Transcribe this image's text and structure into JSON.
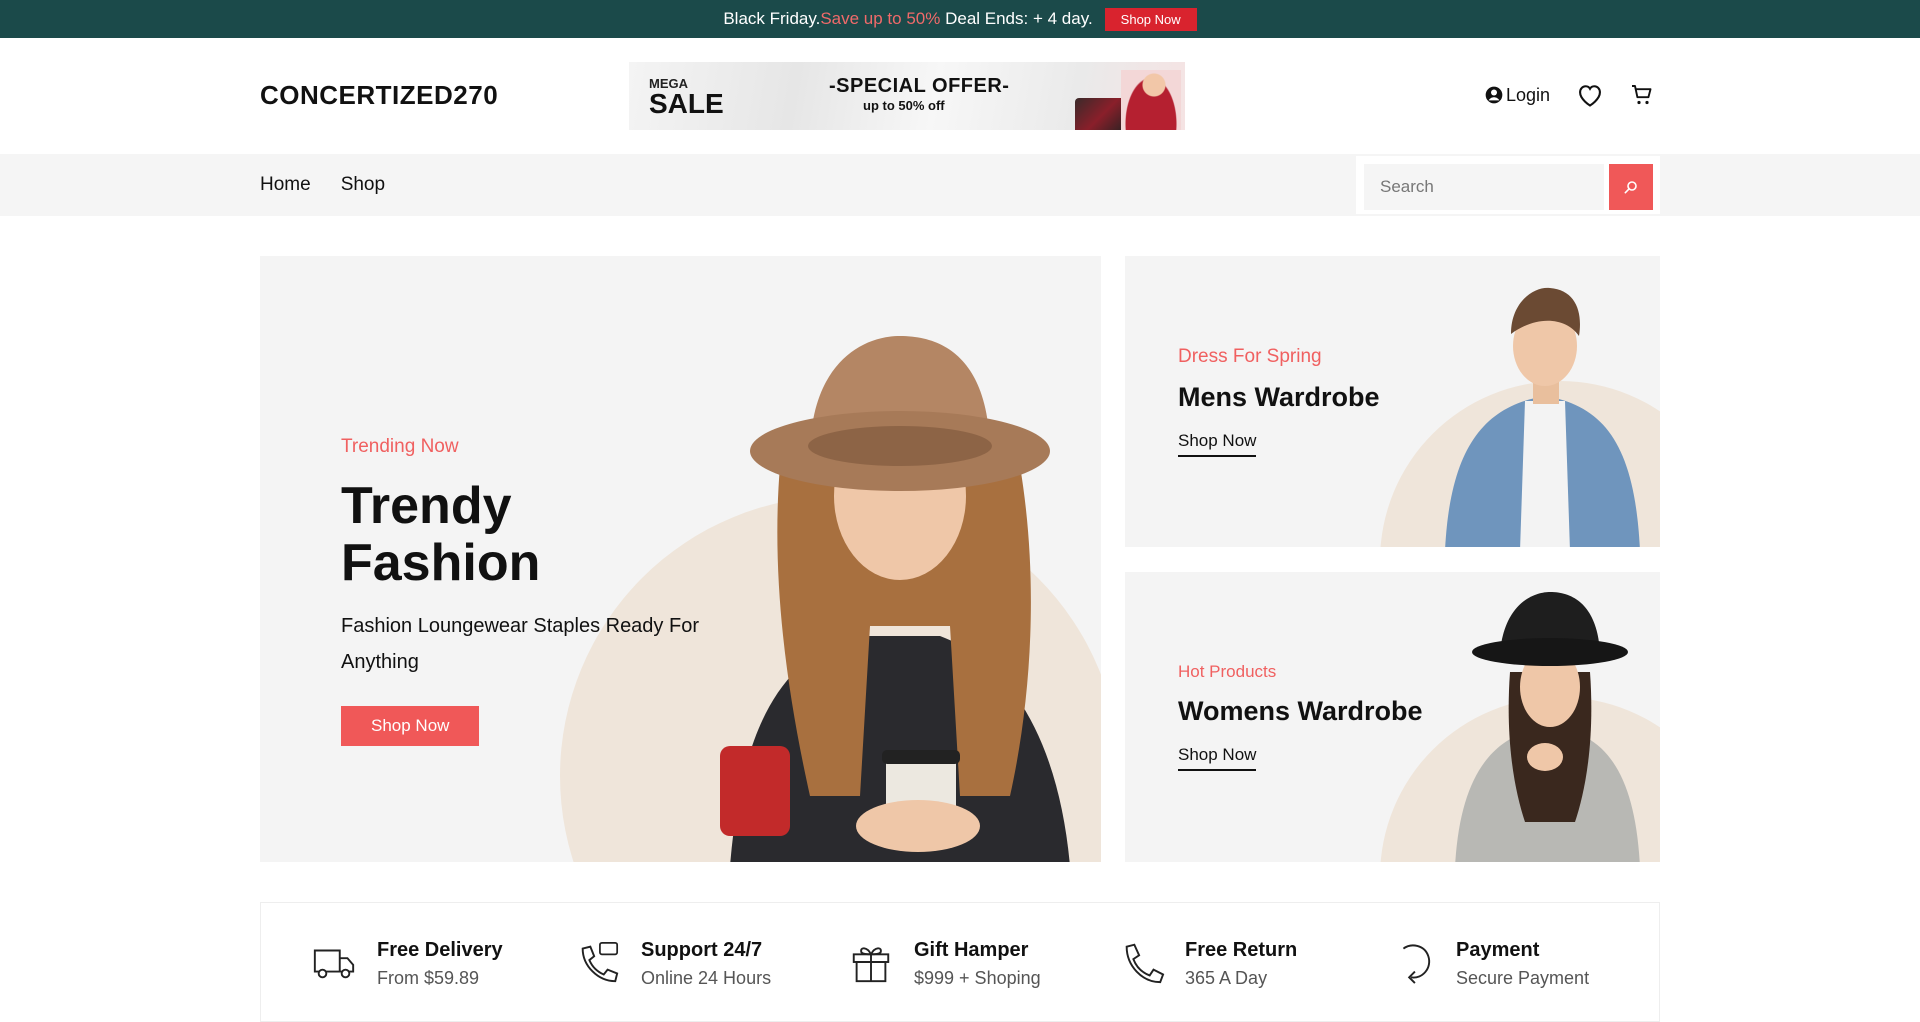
{
  "topbar": {
    "prefix": "Black Friday.",
    "highlight": "Save up to 50%",
    "suffix": " Deal Ends: + 4 day.",
    "button": "Shop Now"
  },
  "header": {
    "logo": "CONCERTIZED270",
    "promo": {
      "mega": "MEGA",
      "sale": "SALE",
      "special": "-SPECIAL OFFER-",
      "upto": "up to 50% off"
    },
    "login": "Login"
  },
  "nav": {
    "items": [
      "Home",
      "Shop"
    ],
    "search_placeholder": "Search"
  },
  "hero": {
    "eyebrow": "Trending Now",
    "title": "Trendy Fashion",
    "subtitle": "Fashion Loungewear Staples Ready For Anything",
    "button": "Shop Now"
  },
  "cards": [
    {
      "eyebrow": "Dress For Spring",
      "title": "Mens Wardrobe",
      "link": "Shop Now"
    },
    {
      "eyebrow": "Hot Products",
      "title": "Womens Wardrobe",
      "link": "Shop Now"
    }
  ],
  "features": [
    {
      "icon": "truck-icon",
      "title": "Free Delivery",
      "subtitle": "From $59.89"
    },
    {
      "icon": "support-phone-icon",
      "title": "Support 24/7",
      "subtitle": "Online 24 Hours"
    },
    {
      "icon": "gift-icon",
      "title": "Gift Hamper",
      "subtitle": "$999 + Shoping"
    },
    {
      "icon": "phone-icon",
      "title": "Free Return",
      "subtitle": "365 A Day"
    },
    {
      "icon": "refresh-icon",
      "title": "Payment",
      "subtitle": "Secure Payment"
    }
  ],
  "colors": {
    "topbar_bg": "#1b4a4a",
    "accent": "#f05858",
    "topbar_button": "#d9232e"
  }
}
